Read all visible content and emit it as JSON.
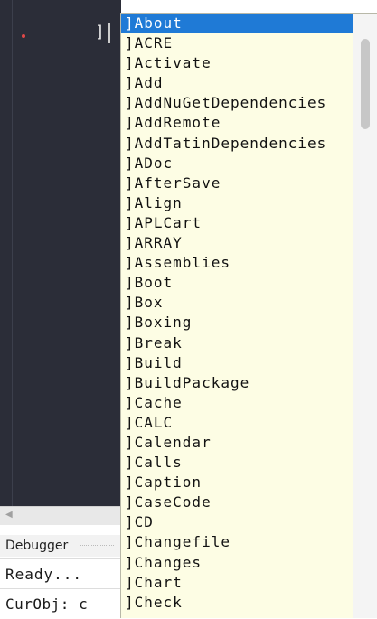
{
  "editor": {
    "prompt": "]"
  },
  "hscroll": {
    "left_arrow": "◀"
  },
  "debugger": {
    "label": "Debugger"
  },
  "status": {
    "text": "Ready..."
  },
  "curobj": {
    "text": "CurObj: c"
  },
  "autocomplete": {
    "selected_index": 0,
    "items": [
      "]About",
      "]ACRE",
      "]Activate",
      "]Add",
      "]AddNuGetDependencies",
      "]AddRemote",
      "]AddTatinDependencies",
      "]ADoc",
      "]AfterSave",
      "]Align",
      "]APLCart",
      "]ARRAY",
      "]Assemblies",
      "]Boot",
      "]Box",
      "]Boxing",
      "]Break",
      "]Build",
      "]BuildPackage",
      "]Cache",
      "]CALC",
      "]Calendar",
      "]Calls",
      "]Caption",
      "]CaseCode",
      "]CD",
      "]Changefile",
      "]Changes",
      "]Chart",
      "]Check"
    ]
  },
  "colors": {
    "editor_bg": "#2b2d38",
    "dropdown_bg": "#fdfde4",
    "selection": "#1f7ad6"
  }
}
